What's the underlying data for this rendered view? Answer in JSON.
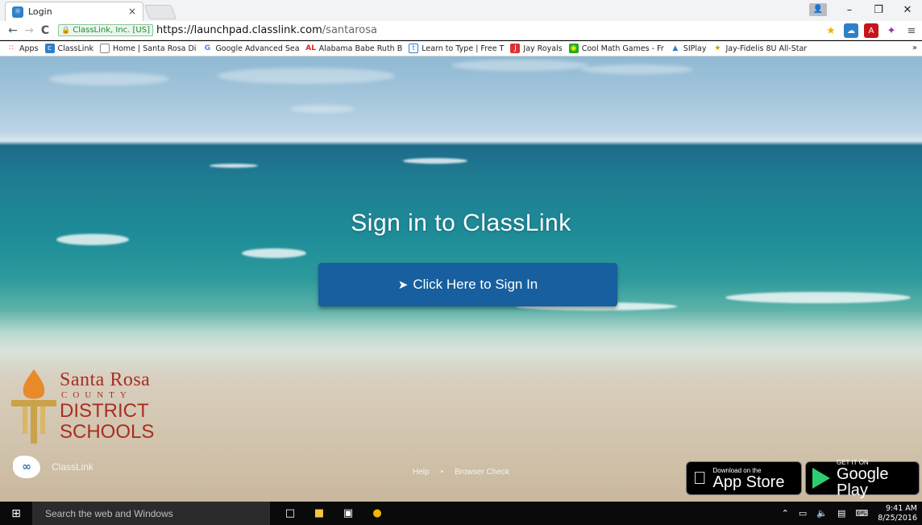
{
  "browser": {
    "tab_title": "Login",
    "tab_close": "×",
    "address": {
      "security_label": "ClassLink, Inc. [US]",
      "url_host": "https://launchpad.classlink.com",
      "url_path": "/santarosa"
    },
    "window_controls": {
      "user": "👤",
      "minimize": "–",
      "maximize": "❐",
      "close": "✕"
    },
    "bookmarks": [
      {
        "label": "Apps",
        "icon": "apps-grid-icon"
      },
      {
        "label": "ClassLink",
        "icon": "classlink-icon"
      },
      {
        "label": "Home | Santa Rosa Di",
        "icon": "page-icon"
      },
      {
        "label": "Google Advanced Sea",
        "icon": "google-icon"
      },
      {
        "label": "Alabama Babe Ruth B",
        "icon": "al-icon"
      },
      {
        "label": "Learn to Type | Free T",
        "icon": "typing-icon"
      },
      {
        "label": "Jay Royals",
        "icon": "jay-royals-icon"
      },
      {
        "label": "Cool Math Games - Fr",
        "icon": "coolmath-icon"
      },
      {
        "label": "SIPlay",
        "icon": "siplay-icon"
      },
      {
        "label": "Jay-Fidelis 8U All-Star",
        "icon": "mc-icon"
      }
    ],
    "bookmarks_more": "»"
  },
  "page": {
    "heading": "Sign in to ClassLink",
    "signin_button": "Click Here to Sign In",
    "district_logo": {
      "line1": "Santa Rosa",
      "line2": "COUNTY",
      "line3": "DISTRICT",
      "line4": "SCHOOLS"
    },
    "footer": {
      "brand": "ClassLink",
      "help": "Help",
      "separator": "•",
      "browser_check": "Browser Check"
    },
    "app_store": {
      "small": "Download on the",
      "big": "App Store"
    },
    "google_play": {
      "small": "GET IT ON",
      "big": "Google Play"
    }
  },
  "taskbar": {
    "search_placeholder": "Search the web and Windows",
    "time": "9:41 AM",
    "date": "8/25/2016"
  },
  "colors": {
    "signin_button": "#175f9e",
    "district_red": "#a82e22",
    "logo_orange": "#e88a2a"
  }
}
